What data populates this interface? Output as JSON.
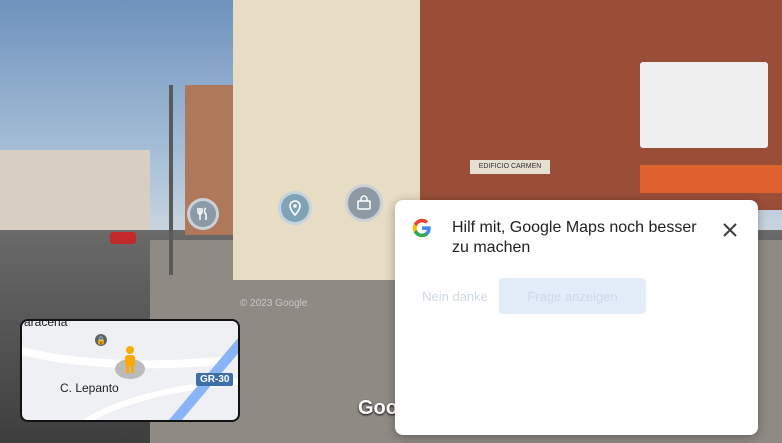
{
  "dialog": {
    "title": "Hilf mit, Google Maps noch besser zu machen",
    "decline_label": "Nein danke",
    "accept_label": "Frage anzeigen",
    "close_icon": "close-icon",
    "logo_icon": "google-logo-icon"
  },
  "minimap": {
    "street_top": "aracena",
    "street_label": "C. Lepanto",
    "road_badge": "GR-30",
    "pegman_icon": "pegman-icon",
    "lock_icon": "lock-icon"
  },
  "scene": {
    "watermark": "Google",
    "copyright": "© 2023 Google",
    "building_sign": "EDIFICIO CARMEN"
  },
  "poi_icons": [
    "restaurant-icon",
    "location-pin-icon",
    "shopping-bag-icon"
  ],
  "colors": {
    "accent": "#1a73e8",
    "road_badge": "#3c6ea8"
  }
}
